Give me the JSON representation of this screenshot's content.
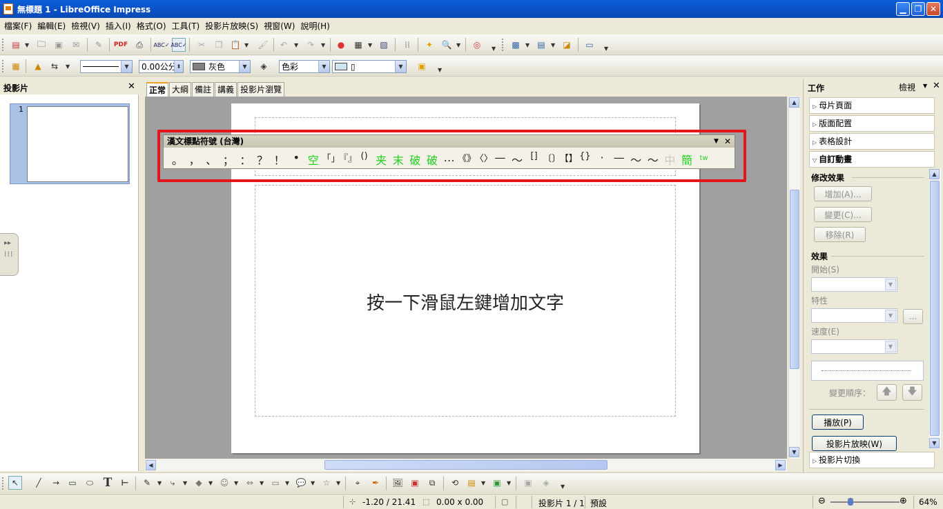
{
  "window": {
    "title": "無標題 1 - LibreOffice Impress"
  },
  "menu": [
    "檔案(F)",
    "編輯(E)",
    "檢視(V)",
    "插入(I)",
    "格式(O)",
    "工具(T)",
    "投影片放映(S)",
    "視窗(W)",
    "說明(H)"
  ],
  "line_toolbar": {
    "line_width": "0.00公分",
    "line_color": "灰色",
    "area_style": "色彩",
    "area_color": "▯",
    "line_color_hex": "#808080",
    "area_color_hex": "#cfe6f0"
  },
  "slides_pane": {
    "title": "投影片",
    "slide_number": "1"
  },
  "view_tabs": [
    "正常",
    "大綱",
    "備註",
    "講義",
    "投影片瀏覽"
  ],
  "slide": {
    "content_placeholder": "按一下滑鼠左鍵增加文字"
  },
  "punctuation_toolbar": {
    "title": "漢文標點符號 (台灣)",
    "symbols": [
      {
        "ch": "。",
        "style": "normal"
      },
      {
        "ch": "，",
        "style": "normal"
      },
      {
        "ch": "、",
        "style": "normal"
      },
      {
        "ch": "；",
        "style": "normal"
      },
      {
        "ch": "：",
        "style": "normal"
      },
      {
        "ch": "？",
        "style": "normal"
      },
      {
        "ch": "！",
        "style": "normal"
      },
      {
        "ch": "•",
        "style": "normal"
      },
      {
        "ch": "空",
        "style": "green"
      },
      {
        "ch": "「」",
        "style": "normal"
      },
      {
        "ch": "『』",
        "style": "normal"
      },
      {
        "ch": "()",
        "style": "normal"
      },
      {
        "ch": "夹",
        "style": "green"
      },
      {
        "ch": "末",
        "style": "green"
      },
      {
        "ch": "破",
        "style": "green"
      },
      {
        "ch": "破",
        "style": "green"
      },
      {
        "ch": "…",
        "style": "normal"
      },
      {
        "ch": "《》",
        "style": "normal"
      },
      {
        "ch": "〈〉",
        "style": "normal"
      },
      {
        "ch": "—",
        "style": "normal"
      },
      {
        "ch": "～",
        "style": "normal"
      },
      {
        "ch": "[]",
        "style": "normal"
      },
      {
        "ch": "〔〕",
        "style": "normal"
      },
      {
        "ch": "【】",
        "style": "normal"
      },
      {
        "ch": "{}",
        "style": "normal"
      },
      {
        "ch": "·",
        "style": "normal"
      },
      {
        "ch": "—",
        "style": "normal"
      },
      {
        "ch": "～",
        "style": "normal"
      },
      {
        "ch": "～",
        "style": "normal"
      },
      {
        "ch": "中",
        "style": "dim"
      },
      {
        "ch": "簡",
        "style": "green"
      },
      {
        "ch": "tw",
        "style": "green"
      }
    ]
  },
  "task_pane": {
    "title": "工作",
    "view_label": "檢視",
    "sections": [
      "母片頁面",
      "版面配置",
      "表格設計",
      "自訂動畫"
    ],
    "modify_effect": "修改效果",
    "add": "增加(A)...",
    "change": "變更(C)...",
    "remove": "移除(R)",
    "effect": "效果",
    "start": "開始(S)",
    "property": "特性",
    "speed": "速度(E)",
    "more": "...",
    "change_order": "變更順序：",
    "play": "播放(P)",
    "slideshow": "投影片放映(W)",
    "transition": "投影片切換"
  },
  "status": {
    "position": "-1.20 / 21.41",
    "size": "0.00 x 0.00",
    "slide": "投影片 1 / 1",
    "layout": "預設",
    "zoom": "64%"
  }
}
